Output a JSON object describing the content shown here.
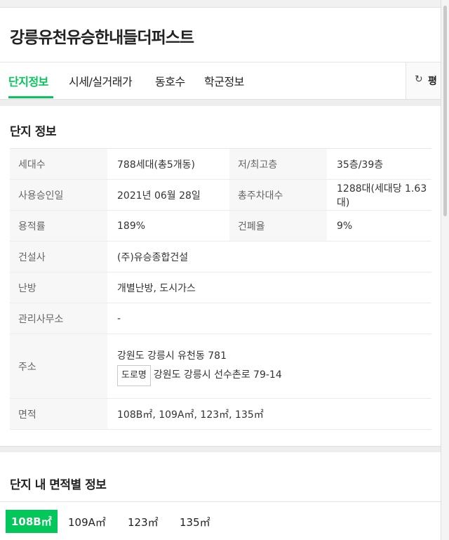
{
  "title": "강릉유천유승한내들더퍼스트",
  "tabs": [
    {
      "label": "단지정보"
    },
    {
      "label": "시세/실거래가"
    },
    {
      "label": "동호수"
    },
    {
      "label": "학군정보"
    }
  ],
  "unit_toggle": {
    "icon": "refresh-icon",
    "label": "평",
    "refresh_glyph": "↻"
  },
  "section1_title": "단지 정보",
  "info": {
    "households_label": "세대수",
    "households_value": "788세대(총5개동)",
    "floors_label": "저/최고층",
    "floors_value": "35층/39층",
    "approval_label": "사용승인일",
    "approval_value": "2021년 06월 28일",
    "parking_label": "총주차대수",
    "parking_value": "1288대(세대당 1.63대)",
    "far_label": "용적률",
    "far_value": "189%",
    "bcr_label": "건폐율",
    "bcr_value": "9%",
    "builder_label": "건설사",
    "builder_value": "(주)유승종합건설",
    "heating_label": "난방",
    "heating_value": "개별난방, 도시가스",
    "office_label": "관리사무소",
    "office_value": "-",
    "address_label": "주소",
    "address_lot": "강원도 강릉시 유천동 781",
    "road_badge": "도로명",
    "address_road": "강원도 강릉시 선수촌로 79-14",
    "area_label": "면적",
    "area_value": "108B㎡, 109A㎡, 123㎡, 135㎡"
  },
  "section2_title": "단지 내 면적별 정보",
  "area_tabs": [
    {
      "label": "108B㎡",
      "active": true
    },
    {
      "label": "109A㎡",
      "active": false
    },
    {
      "label": "123㎡",
      "active": false
    },
    {
      "label": "135㎡",
      "active": false
    }
  ],
  "colors": {
    "accent": "#03c75a"
  }
}
